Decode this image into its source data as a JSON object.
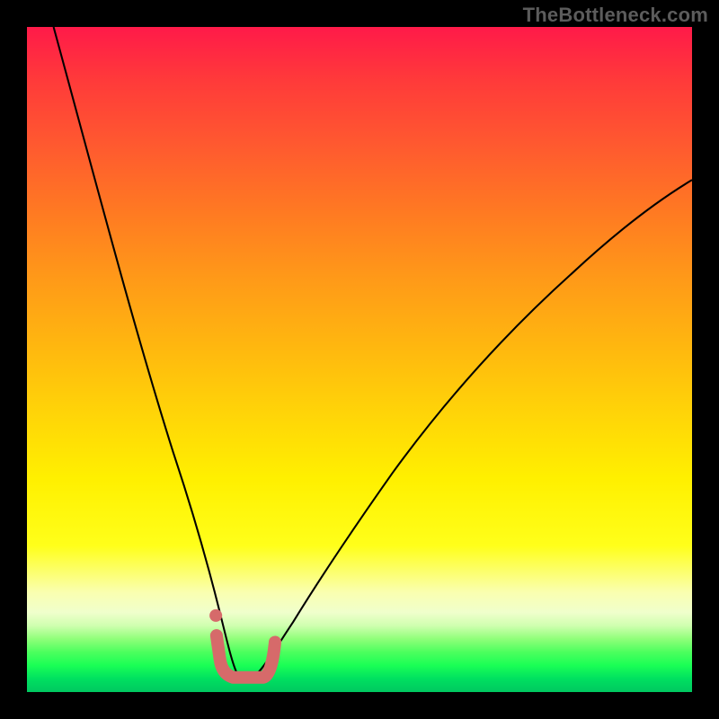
{
  "watermark": "TheBottleneck.com",
  "chart_data": {
    "type": "line",
    "title": "",
    "xlabel": "",
    "ylabel": "",
    "xlim": [
      0,
      100
    ],
    "ylim": [
      0,
      100
    ],
    "gradient_meaning": "background color encodes bottleneck severity (red=high, green=low)",
    "series": [
      {
        "name": "bottleneck-curve",
        "note": "V-shaped curve; minimum near x≈33, y≈2. Values estimated from pixels.",
        "x": [
          4,
          8,
          12,
          16,
          20,
          24,
          27,
          29,
          31,
          33,
          35,
          37,
          40,
          45,
          50,
          57,
          65,
          75,
          85,
          95,
          100
        ],
        "y": [
          100,
          85,
          70,
          55,
          40,
          26,
          15,
          8,
          4,
          2,
          3,
          5,
          9,
          17,
          25,
          35,
          45,
          56,
          65,
          73,
          77
        ]
      },
      {
        "name": "highlight-bracket",
        "note": "thick pink/red segment emphasizing the low-bottleneck range",
        "x": [
          28.5,
          29,
          30,
          31,
          32,
          33,
          34,
          35,
          36,
          37.3
        ],
        "y": [
          8.5,
          5,
          3,
          2.3,
          2,
          2,
          2,
          2.3,
          3.5,
          7.5
        ]
      },
      {
        "name": "highlight-dot",
        "note": "single marker just above left end of bracket",
        "x": [
          28.4
        ],
        "y": [
          11.5
        ]
      }
    ]
  },
  "colors": {
    "curve": "#000000",
    "highlight": "#d66a6a",
    "background_top": "#ff1a49",
    "background_bottom": "#00c860"
  }
}
